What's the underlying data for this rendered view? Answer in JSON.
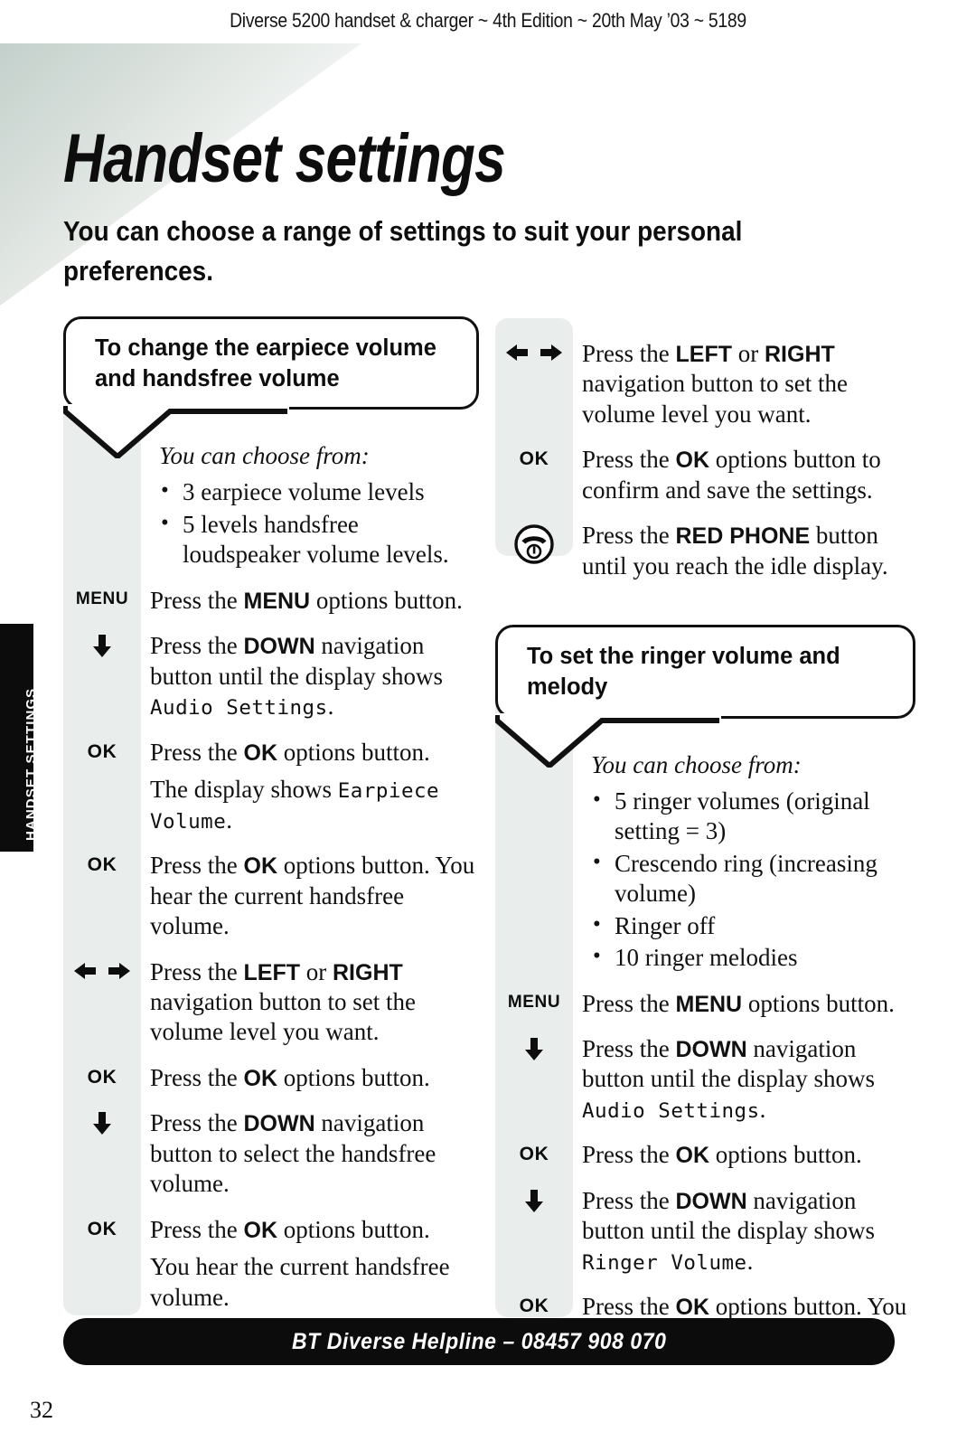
{
  "header": {
    "running_head": "Diverse 5200 handset & charger ~ 4th Edition ~ 20th May ’03 ~ 5189"
  },
  "side_tab": {
    "label": "HANDSET SETTINGS"
  },
  "title": {
    "heading": "Handset settings",
    "subheading": "You can choose a range of settings to suit your personal preferences."
  },
  "left_column": {
    "callout": "To change the earpiece volume and handsfree volume",
    "choose_intro": "You can choose from:",
    "choose_items": [
      "3 earpiece volume levels",
      "5 levels handsfree loudspeaker volume levels."
    ],
    "steps": [
      {
        "icon": "MENU",
        "icon_type": "text",
        "text_html": "Press the <b>MENU</b> options button."
      },
      {
        "icon": "DOWN",
        "icon_type": "arrow-down",
        "text_html": "Press the <b>DOWN</b> navigation button until the display shows <span class=\"lcd\">Audio Settings</span>."
      },
      {
        "icon": "OK",
        "icon_type": "text",
        "text_html": "Press the <b>OK</b> options button."
      },
      {
        "icon": "",
        "icon_type": "none",
        "text_html": "The display shows <span class=\"lcd\">Earpiece Volume</span>."
      },
      {
        "icon": "OK",
        "icon_type": "text",
        "text_html": "Press the <b>OK</b> options button. You hear the current handsfree volume."
      },
      {
        "icon": "LEFT-RIGHT",
        "icon_type": "arrow-lr",
        "text_html": "Press the <b>LEFT</b> or <b>RIGHT</b> navigation button to set the volume level you want."
      },
      {
        "icon": "OK",
        "icon_type": "text",
        "text_html": "Press the <b>OK</b> options button."
      },
      {
        "icon": "DOWN",
        "icon_type": "arrow-down",
        "text_html": "Press the <b>DOWN</b> navigation button to select the handsfree volume."
      },
      {
        "icon": "OK",
        "icon_type": "text",
        "text_html": "Press the <b>OK</b> options button."
      },
      {
        "icon": "",
        "icon_type": "none",
        "text_html": "You hear the current handsfree volume."
      }
    ]
  },
  "right_column_top": {
    "steps": [
      {
        "icon": "LEFT-RIGHT",
        "icon_type": "arrow-lr",
        "text_html": "Press the <b>LEFT</b> or <b>RIGHT</b> navigation button to set the volume level you want."
      },
      {
        "icon": "OK",
        "icon_type": "text",
        "text_html": "Press the <b>OK</b> options button to confirm and save the settings."
      },
      {
        "icon": "RED PHONE",
        "icon_type": "phone",
        "text_html": "Press the <b>RED PHONE</b> button until you reach the idle display."
      }
    ]
  },
  "right_column_bottom": {
    "callout": "To set the ringer volume and melody",
    "choose_intro": "You can choose from:",
    "choose_items": [
      "5 ringer volumes (original setting = 3)",
      "Crescendo ring (increasing volume)",
      "Ringer off",
      "10 ringer melodies"
    ],
    "steps": [
      {
        "icon": "MENU",
        "icon_type": "text",
        "text_html": "Press the <b>MENU</b> options button."
      },
      {
        "icon": "DOWN",
        "icon_type": "arrow-down",
        "text_html": "Press the <b>DOWN</b> navigation button until the display shows <span class=\"lcd\">Audio Settings</span>."
      },
      {
        "icon": "OK",
        "icon_type": "text",
        "text_html": "Press the <b>OK</b> options button."
      },
      {
        "icon": "DOWN",
        "icon_type": "arrow-down",
        "text_html": "Press the <b>DOWN</b> navigation button until the display shows <span class=\"lcd\">Ringer Volume</span>."
      },
      {
        "icon": "OK",
        "icon_type": "text",
        "text_html": "Press the <b>OK</b> options button. You hear the current ringer volume."
      }
    ]
  },
  "footer": {
    "helpline": "BT Diverse Helpline – 08457 908 070",
    "page_number": "32"
  },
  "colors": {
    "ink": "#0c0c0c",
    "gutter_grey": "#e9edeb",
    "corner_tint": "#c3d0cb"
  }
}
